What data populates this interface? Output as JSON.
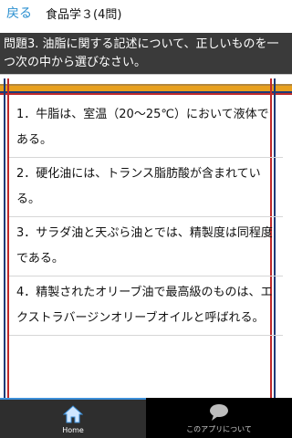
{
  "header": {
    "back_label": "戻る",
    "title": "食品学３(4問)"
  },
  "question": {
    "text": "問題3. 油脂に関する記述について、正しいものを一つ次の中から選びなさい。"
  },
  "options": [
    {
      "text": "1．牛脂は、室温（20〜25℃）において液体である。"
    },
    {
      "text": "2．硬化油には、トランス脂肪酸が含まれている。"
    },
    {
      "text": "3．サラダ油と天ぷら油とでは、精製度は同程度である。"
    },
    {
      "text": "4．精製されたオリーブ油で最高級のものは、エクストラバージンオリーブオイルと呼ばれる。"
    }
  ],
  "bottom_nav": {
    "items": [
      {
        "label": "Home",
        "icon": "home-icon",
        "active": true
      },
      {
        "label": "このアプリについて",
        "icon": "chat-bubble-icon",
        "active": false
      }
    ]
  },
  "colors": {
    "accent": "#2a8fd0",
    "question_bg": "#3a3a3a",
    "bar_orange": "#e8a01e",
    "bar_red": "#c02a2a",
    "bar_blue": "#1d3b78"
  }
}
